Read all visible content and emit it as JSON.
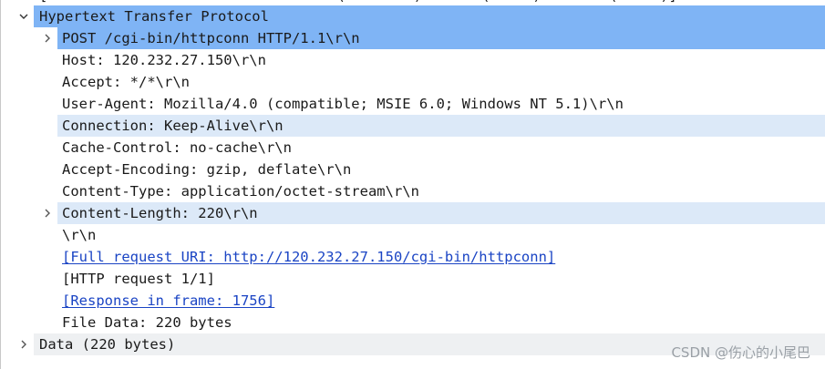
{
  "cutoff_line": "[                                  (        )       (     )        (     )]",
  "http_header": {
    "label": "Hypertext Transfer Protocol",
    "expanded": true,
    "icon": "chevron-down-icon"
  },
  "rows": [
    {
      "text": "POST /cgi-bin/httpconn HTTP/1.1\\r\\n",
      "expandable": true,
      "state": "selected"
    },
    {
      "text": "Host: 120.232.27.150\\r\\n"
    },
    {
      "text": "Accept: */*\\r\\n"
    },
    {
      "text": "User-Agent: Mozilla/4.0 (compatible; MSIE 6.0; Windows NT 5.1)\\r\\n"
    },
    {
      "text": "Connection: Keep-Alive\\r\\n",
      "state": "hover"
    },
    {
      "text": "Cache-Control: no-cache\\r\\n"
    },
    {
      "text": "Accept-Encoding: gzip, deflate\\r\\n"
    },
    {
      "text": "Content-Type: application/octet-stream\\r\\n"
    },
    {
      "text": "Content-Length: 220\\r\\n",
      "expandable": true,
      "state": "hover"
    },
    {
      "text": "\\r\\n"
    },
    {
      "text": "[Full request URI: http://120.232.27.150/cgi-bin/httpconn]",
      "link": true
    },
    {
      "text": "[HTTP request 1/1]"
    },
    {
      "text": "[Response in frame: 1756]",
      "link": true
    },
    {
      "text": "File Data: 220 bytes"
    }
  ],
  "data_row": {
    "label": "Data (220 bytes)",
    "expanded": false,
    "icon": "chevron-right-icon"
  },
  "watermark": "CSDN @伤心的小尾巴",
  "colors": {
    "selected": "#7fb4f5",
    "hover": "#dce9f8",
    "link": "#1a44c4",
    "data_row": "#eef0f2"
  }
}
